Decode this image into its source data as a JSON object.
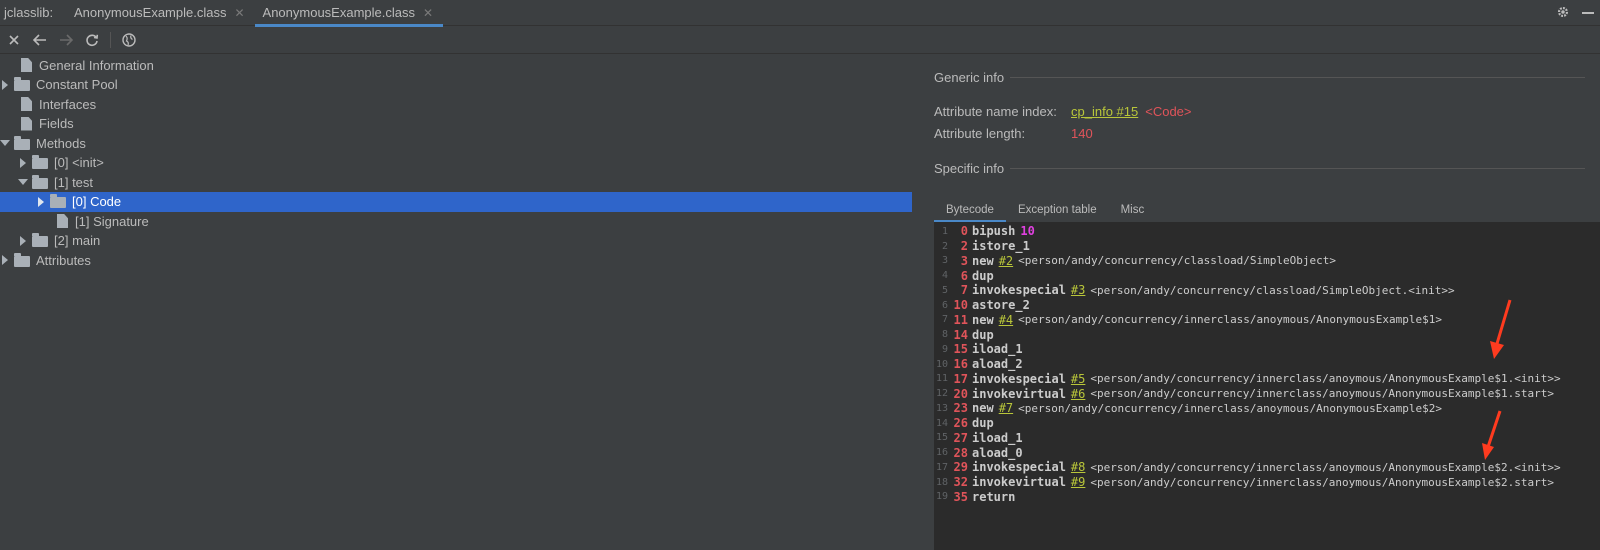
{
  "tabbar": {
    "app_name": "jclasslib:",
    "tabs": [
      {
        "label": "AnonymousExample.class"
      },
      {
        "label": "AnonymousExample.class"
      }
    ]
  },
  "tree": {
    "items": [
      {
        "label": "General Information",
        "icon": "file"
      },
      {
        "label": "Constant Pool",
        "icon": "folder"
      },
      {
        "label": "Interfaces",
        "icon": "file"
      },
      {
        "label": "Fields",
        "icon": "file"
      },
      {
        "label": "Methods",
        "icon": "folder"
      },
      {
        "label": "[0] <init>",
        "icon": "folder"
      },
      {
        "label": "[1] test",
        "icon": "folder"
      },
      {
        "label": "[0] Code",
        "icon": "folder"
      },
      {
        "label": "[1] Signature",
        "icon": "file"
      },
      {
        "label": "[2] main",
        "icon": "folder"
      },
      {
        "label": "Attributes",
        "icon": "folder"
      }
    ]
  },
  "generic_info": {
    "title": "Generic info",
    "name_index_label": "Attribute name index:",
    "name_index_link": "cp_info #15",
    "name_index_value": "<Code>",
    "length_label": "Attribute length:",
    "length_value": "140"
  },
  "specific_info": {
    "title": "Specific info",
    "tabs": [
      "Bytecode",
      "Exception table",
      "Misc"
    ]
  },
  "bytecode": [
    {
      "ln": "1",
      "off": "0",
      "op": "bipush",
      "ref": "",
      "comment": "",
      "num": "10"
    },
    {
      "ln": "2",
      "off": "2",
      "op": "istore_1",
      "ref": "",
      "comment": "",
      "num": ""
    },
    {
      "ln": "3",
      "off": "3",
      "op": "new",
      "ref": "#2",
      "comment": "<person/andy/concurrency/classload/SimpleObject>",
      "num": ""
    },
    {
      "ln": "4",
      "off": "6",
      "op": "dup",
      "ref": "",
      "comment": "",
      "num": ""
    },
    {
      "ln": "5",
      "off": "7",
      "op": "invokespecial",
      "ref": "#3",
      "comment": "<person/andy/concurrency/classload/SimpleObject.<init>>",
      "num": ""
    },
    {
      "ln": "6",
      "off": "10",
      "op": "astore_2",
      "ref": "",
      "comment": "",
      "num": ""
    },
    {
      "ln": "7",
      "off": "11",
      "op": "new",
      "ref": "#4",
      "comment": "<person/andy/concurrency/innerclass/anoymous/AnonymousExample$1>",
      "num": ""
    },
    {
      "ln": "8",
      "off": "14",
      "op": "dup",
      "ref": "",
      "comment": "",
      "num": ""
    },
    {
      "ln": "9",
      "off": "15",
      "op": "iload_1",
      "ref": "",
      "comment": "",
      "num": ""
    },
    {
      "ln": "10",
      "off": "16",
      "op": "aload_2",
      "ref": "",
      "comment": "",
      "num": ""
    },
    {
      "ln": "11",
      "off": "17",
      "op": "invokespecial",
      "ref": "#5",
      "comment": "<person/andy/concurrency/innerclass/anoymous/AnonymousExample$1.<init>>",
      "num": ""
    },
    {
      "ln": "12",
      "off": "20",
      "op": "invokevirtual",
      "ref": "#6",
      "comment": "<person/andy/concurrency/innerclass/anoymous/AnonymousExample$1.start>",
      "num": ""
    },
    {
      "ln": "13",
      "off": "23",
      "op": "new",
      "ref": "#7",
      "comment": "<person/andy/concurrency/innerclass/anoymous/AnonymousExample$2>",
      "num": ""
    },
    {
      "ln": "14",
      "off": "26",
      "op": "dup",
      "ref": "",
      "comment": "",
      "num": ""
    },
    {
      "ln": "15",
      "off": "27",
      "op": "iload_1",
      "ref": "",
      "comment": "",
      "num": ""
    },
    {
      "ln": "16",
      "off": "28",
      "op": "aload_0",
      "ref": "",
      "comment": "",
      "num": ""
    },
    {
      "ln": "17",
      "off": "29",
      "op": "invokespecial",
      "ref": "#8",
      "comment": "<person/andy/concurrency/innerclass/anoymous/AnonymousExample$2.<init>>",
      "num": ""
    },
    {
      "ln": "18",
      "off": "32",
      "op": "invokevirtual",
      "ref": "#9",
      "comment": "<person/andy/concurrency/innerclass/anoymous/AnonymousExample$2.start>",
      "num": ""
    },
    {
      "ln": "19",
      "off": "35",
      "op": "return",
      "ref": "",
      "comment": "",
      "num": ""
    }
  ],
  "colors": {
    "selection": "#2f65ca",
    "accent": "#4a88c7",
    "offset": "#e0545a",
    "link": "#b9c63a",
    "annotation_arrow": "#ff3b1f"
  }
}
